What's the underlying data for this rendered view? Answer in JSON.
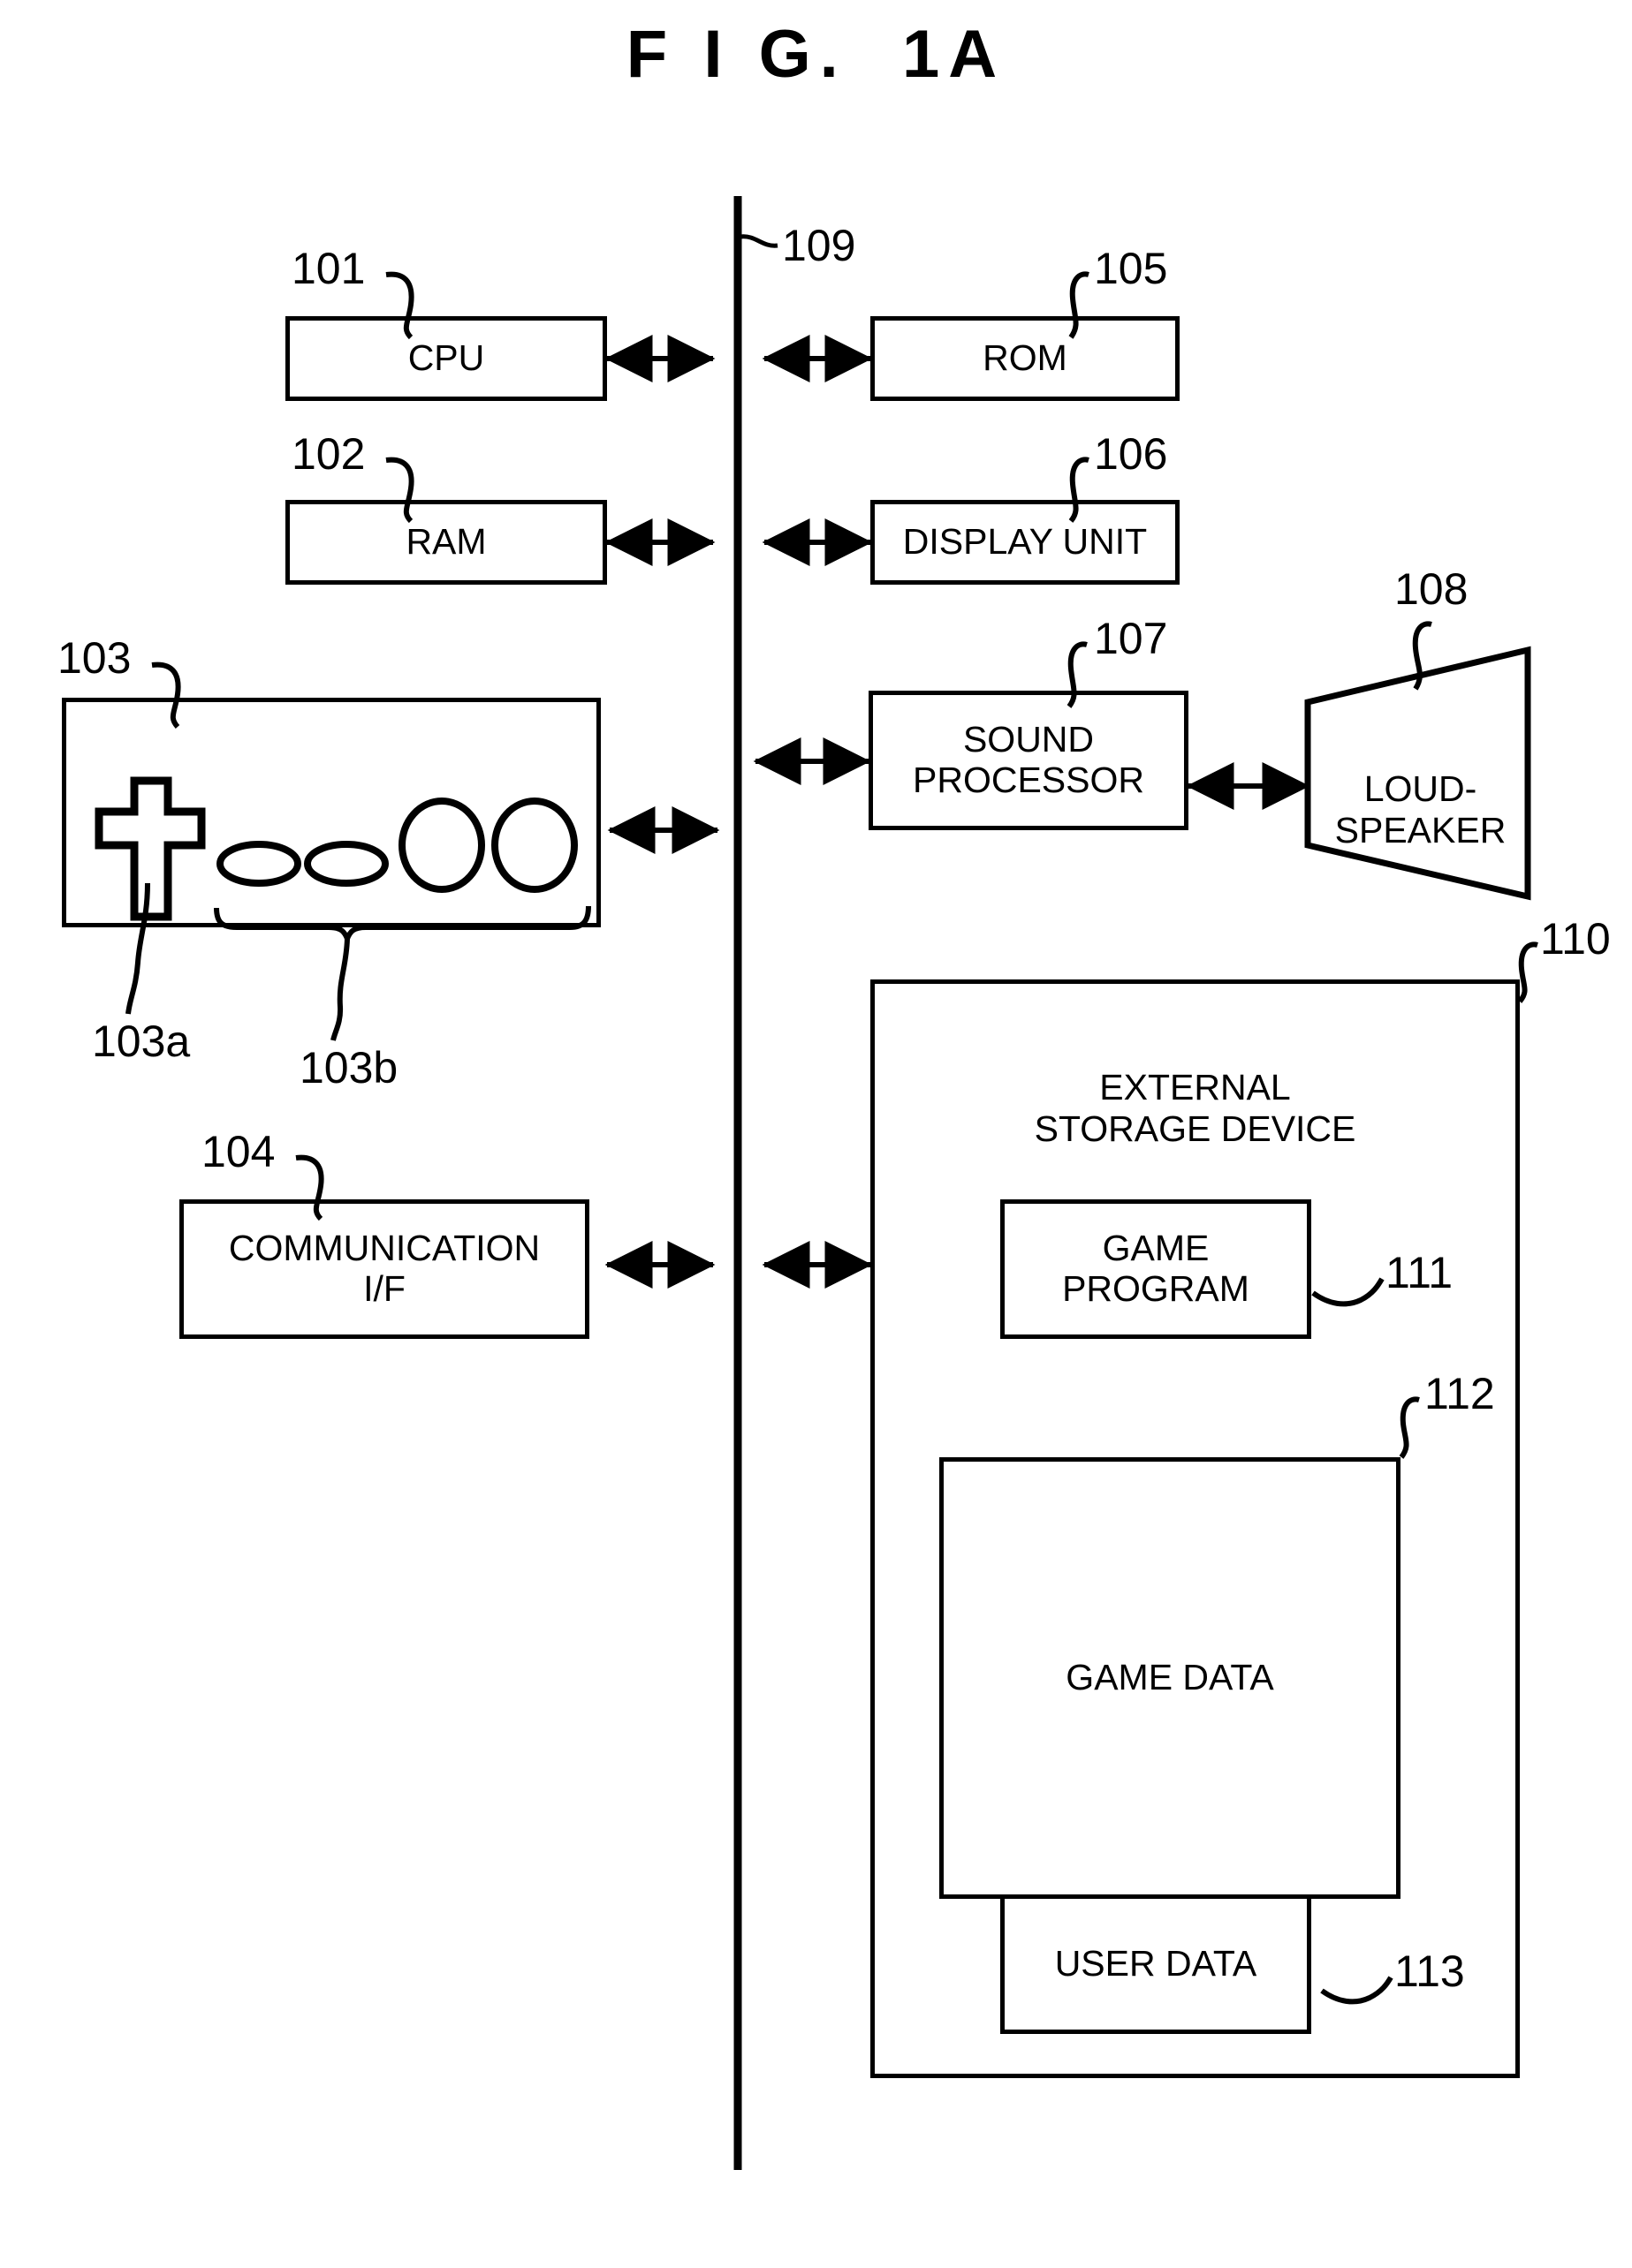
{
  "figure": {
    "title": "F I G.  1A"
  },
  "bus": {
    "ref": "109",
    "name": "system-bus"
  },
  "blocks": {
    "cpu": {
      "ref": "101",
      "label": "CPU"
    },
    "ram": {
      "ref": "102",
      "label": "RAM"
    },
    "operation_unit": {
      "ref": "103",
      "label": ""
    },
    "comm_if": {
      "ref": "104",
      "label": "COMMUNICATION\nI/F"
    },
    "rom": {
      "ref": "105",
      "label": "ROM"
    },
    "display_unit": {
      "ref": "106",
      "label": "DISPLAY UNIT"
    },
    "sound_processor": {
      "ref": "107",
      "label": "SOUND\nPROCESSOR"
    },
    "loudspeaker": {
      "ref": "108",
      "label": "LOUD-\nSPEAKER"
    },
    "external_storage": {
      "ref": "110",
      "label": "EXTERNAL\nSTORAGE DEVICE"
    },
    "game_program": {
      "ref": "111",
      "label": "GAME\nPROGRAM"
    },
    "game_data": {
      "ref": "112",
      "label": "GAME DATA"
    },
    "user_data": {
      "ref": "113",
      "label": "USER DATA"
    }
  },
  "controller_parts": {
    "dpad": {
      "ref": "103a",
      "name": "direction-pad"
    },
    "buttons": {
      "ref": "103b",
      "name": "button-group"
    }
  }
}
